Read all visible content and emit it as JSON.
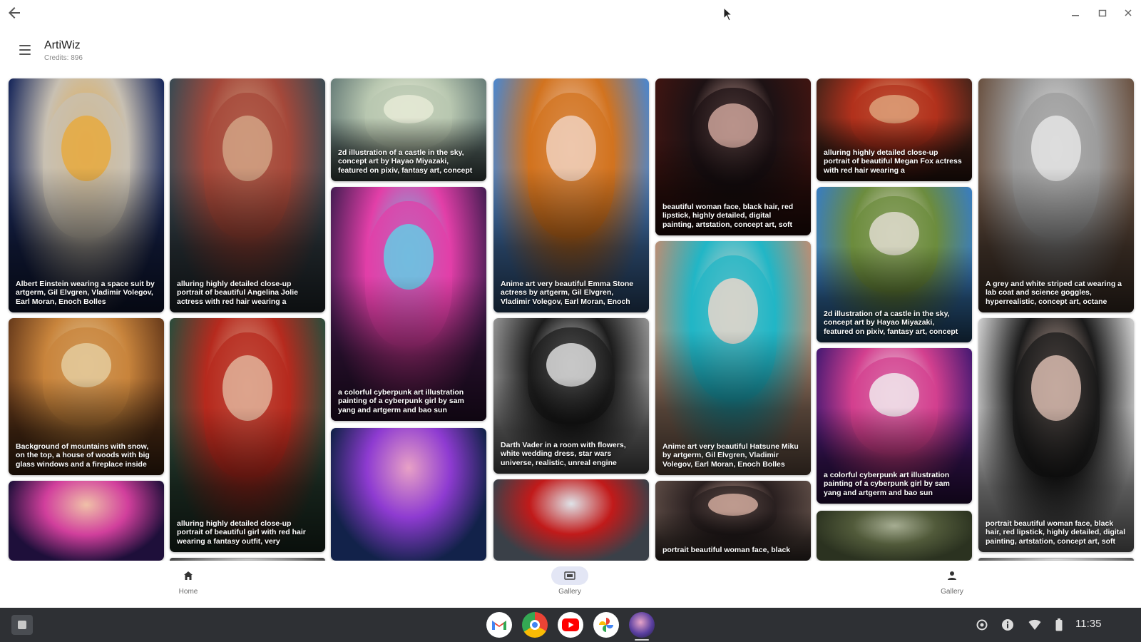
{
  "window": {
    "back_icon": "back-arrow-icon",
    "controls": [
      "minimize-icon",
      "restore-icon",
      "close-icon"
    ]
  },
  "appbar": {
    "title": "ArtiWiz",
    "credits": "Credits: 896"
  },
  "gallery": [
    {
      "prompt": "Albert Einstein wearing a space suit by artgerm, Gil Elvgren, Vladimir Volegov, Earl Moran, Enoch Bolles",
      "palette": [
        "#1b2a5c",
        "#c8c0b2",
        "#e9a93a"
      ]
    },
    {
      "prompt": "alluring highly detailed close-up portrait of beautiful Angelina Jolie actress with red hair wearing a",
      "palette": [
        "#3d4a52",
        "#a5483a",
        "#d4a788"
      ]
    },
    {
      "prompt": "Background of mountains with snow, on the top, a house of woods with big glass windows and a fireplace inside",
      "palette": [
        "#6b3d1c",
        "#c8843c",
        "#e6cfa3"
      ]
    },
    {
      "prompt": "alluring highly detailed close-up portrait of beautiful girl with red hair wearing a fantasy outfit, very",
      "palette": [
        "#2f4b3a",
        "#b62a1e",
        "#e3b9a0"
      ]
    },
    {
      "prompt": "2d illustration of a castle in the sky, concept art by Hayao Miyazaki, featured on pixiv, fantasy art, concept",
      "palette": [
        "#6a7f7a",
        "#b8c7b0",
        "#e9ecd8"
      ]
    },
    {
      "prompt": "a colorful cyberpunk art illustration painting of a cyberpunk girl by sam yang and artgerm and bao sun",
      "palette": [
        "#4b1e56",
        "#e23fa8",
        "#5fd2e8"
      ]
    },
    {
      "prompt": "Anime art very beautiful Emma Stone actress by artgerm, Gil Elvgren, Vladimir Volegov, Earl Moran, Enoch",
      "palette": [
        "#4f86c9",
        "#d2731f",
        "#f2d6c6"
      ]
    },
    {
      "prompt": "Darth Vader in a room with flowers, white wedding dress, star wars universe, realistic, unreal engine",
      "palette": [
        "#8f8f8f",
        "#1c1c1c",
        "#e6e6e6"
      ]
    },
    {
      "prompt": "beautiful woman face, black hair, red lipstick, highly detailed, digital painting, artstation, concept art, soft",
      "palette": [
        "#3e1411",
        "#1d1214",
        "#d4aaa0"
      ]
    },
    {
      "prompt": "Anime art very beautiful Hatsune Miku by artgerm, Gil Elvgren, Vladimir Volegov, Earl Moran, Enoch Bolles",
      "palette": [
        "#b58f77",
        "#21b6c6",
        "#f2d8cc"
      ]
    },
    {
      "prompt": "portrait beautiful woman face, black",
      "palette": [
        "#5b4a44",
        "#2a2020",
        "#d8b0a2"
      ]
    },
    {
      "prompt": "alluring highly detailed close-up portrait of beautiful Megan Fox actress with red hair wearing a",
      "palette": [
        "#4a241a",
        "#b2311c",
        "#e0a67e"
      ]
    },
    {
      "prompt": "2d illustration of a castle in the sky, concept art by Hayao Miyazaki, featured on pixiv, fantasy art, concept",
      "palette": [
        "#3a7dbd",
        "#6c8c3e",
        "#e6e0d6"
      ]
    },
    {
      "prompt": "a colorful cyberpunk art illustration painting of a cyberpunk girl by sam yang and artgerm and bao sun",
      "palette": [
        "#4a1a73",
        "#d3408f",
        "#f2f2f2"
      ]
    },
    {
      "prompt": "A grey and white striped cat wearing a lab coat and science goggles, hyperrealistic, concept art, octane",
      "palette": [
        "#6c5444",
        "#9c9c9c",
        "#e8e8e8"
      ]
    },
    {
      "prompt": "portrait beautiful woman face, black hair, red lipstick, highly detailed, digital painting, artstation, concept art, soft",
      "palette": [
        "#c9c9c9",
        "#1a1a1a",
        "#e2c3b6"
      ]
    }
  ],
  "bottom_nav": [
    {
      "label": "Home",
      "icon": "home-icon"
    },
    {
      "label": "Gallery",
      "icon": "gallery-icon"
    },
    {
      "label": "Gallery",
      "icon": "profile-icon"
    }
  ],
  "shelf": {
    "apps": [
      {
        "name": "Gmail",
        "icon": "gmail-icon",
        "glyph": "M",
        "color": "#ea4335"
      },
      {
        "name": "Chrome",
        "icon": "chrome-icon",
        "glyph": "",
        "color": "#4285f4"
      },
      {
        "name": "YouTube",
        "icon": "youtube-icon",
        "glyph": "▶",
        "color": "#ff0000"
      },
      {
        "name": "Photos",
        "icon": "photos-icon",
        "glyph": "✱",
        "color": "#fbbc05"
      },
      {
        "name": "ArtiWiz",
        "icon": "artiwiz-icon",
        "glyph": "",
        "color": "#5a3fa0"
      }
    ],
    "clock": "11:35"
  }
}
